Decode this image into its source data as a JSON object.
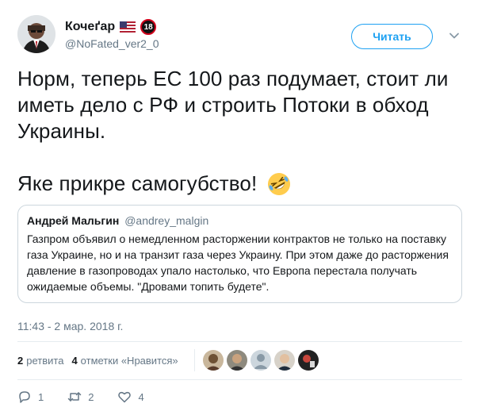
{
  "user": {
    "display_name": "Кочеґар",
    "handle": "@NoFated_ver2_0",
    "badge": "18"
  },
  "header": {
    "follow_label": "Читать"
  },
  "tweet": {
    "line1": "Норм, теперь ЕС 100 раз подумает, стоит ли иметь дело с РФ и строить Потоки в обход Украины.",
    "line2": "Яке прикре самогубство!",
    "emoji": "rolling-on-floor-laughing-emoji"
  },
  "quote": {
    "name": "Андрей Мальгин",
    "handle": "@andrey_malgin",
    "text": "Газпром объявил о немедленном расторжении контрактов не только на поставку газа Украине, но и на транзит газа через Украину. При этом даже до расторжения давление в газопроводах упало настолько, что Европа перестала получать ожидаемые объемы. \"Дровами топить будете\"."
  },
  "timestamp": "11:43 - 2 мар. 2018 г.",
  "stats": {
    "retweets_count": "2",
    "retweets_label": "ретвита",
    "likes_count": "4",
    "likes_label": "отметки «Нравится»"
  },
  "actions": {
    "reply_count": "1",
    "retweet_count": "2",
    "like_count": "4"
  },
  "colors": {
    "accent": "#1da1f2",
    "muted": "#657786",
    "border": "#ccd6dd"
  }
}
